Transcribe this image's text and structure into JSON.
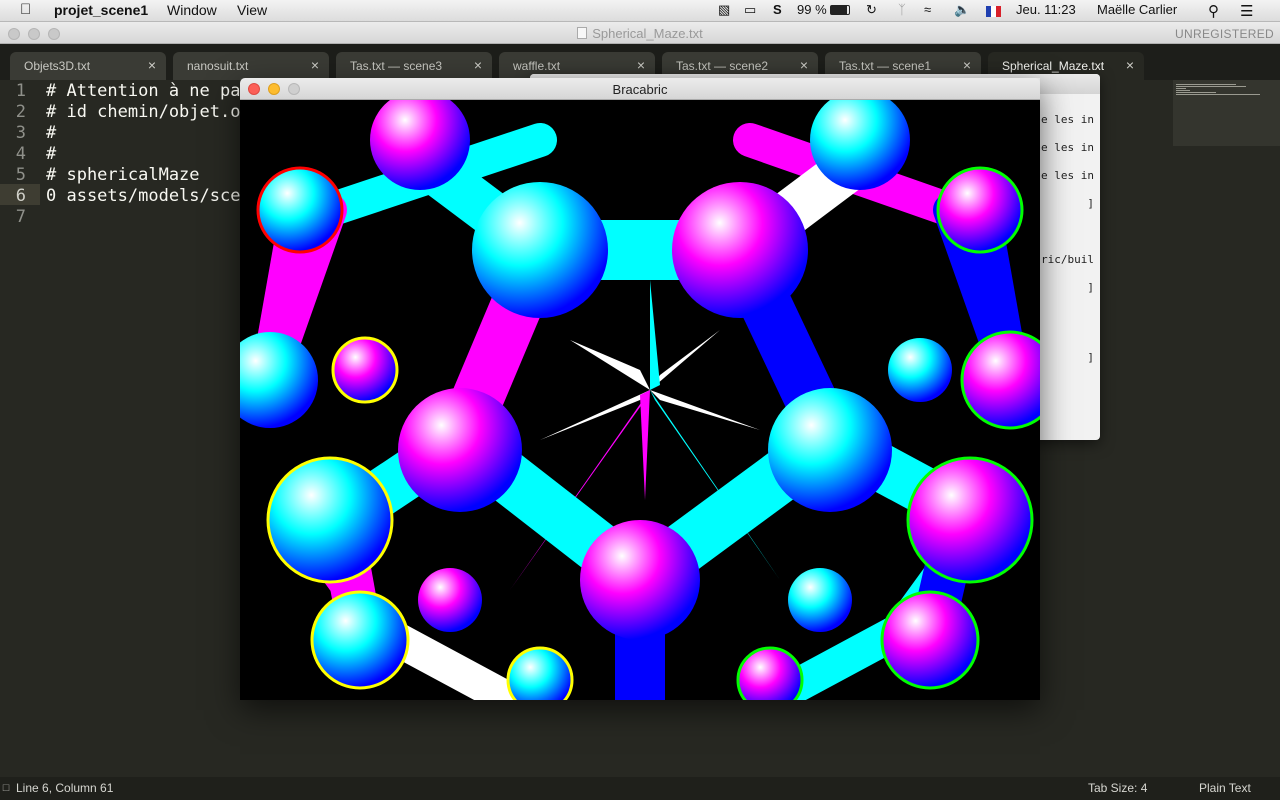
{
  "menubar": {
    "app_name": "projet_scene1",
    "menus": [
      "Window",
      "View"
    ],
    "tray": {
      "battery": "99 %",
      "flag": "France",
      "datetime": "Jeu. 11:23",
      "user": "Maëlle Carlier"
    }
  },
  "sublime": {
    "title": "Spherical_Maze.txt",
    "unregistered": "UNREGISTERED",
    "tabs": [
      {
        "label": "Objets3D.txt",
        "active": false
      },
      {
        "label": "nanosuit.txt",
        "active": false
      },
      {
        "label": "Tas.txt — scene3",
        "active": false
      },
      {
        "label": "waffle.txt",
        "active": false
      },
      {
        "label": "Tas.txt — scene2",
        "active": false
      },
      {
        "label": "Tas.txt — scene1",
        "active": false
      },
      {
        "label": "Spherical_Maze.txt",
        "active": true
      }
    ],
    "close_glyph": "×",
    "lines": [
      {
        "num": "1",
        "text": "# Attention à ne pa"
      },
      {
        "num": "2",
        "text": "# id chemin/objet.o"
      },
      {
        "num": "3",
        "text": "#"
      },
      {
        "num": "4",
        "text": "#"
      },
      {
        "num": "5",
        "text": "# sphericalMaze"
      },
      {
        "num": "6",
        "text": "0 assets/models/sce"
      },
      {
        "num": "7",
        "text": ""
      }
    ],
    "current_line": 6
  },
  "background_window": {
    "fragments": [
      "e les in",
      "e les in",
      "e les in",
      "]",
      "ric/buil",
      "]",
      "]"
    ]
  },
  "bracabric": {
    "title": "Bracabric"
  },
  "statusbar": {
    "position": "Line 6, Column 61",
    "tab_size": "Tab Size: 4",
    "syntax": "Plain Text"
  },
  "colors": {
    "editor_bg": "#272822",
    "magenta": "#ff00ff",
    "cyan": "#00ffff",
    "blue": "#0000ff",
    "white": "#ffffff"
  }
}
